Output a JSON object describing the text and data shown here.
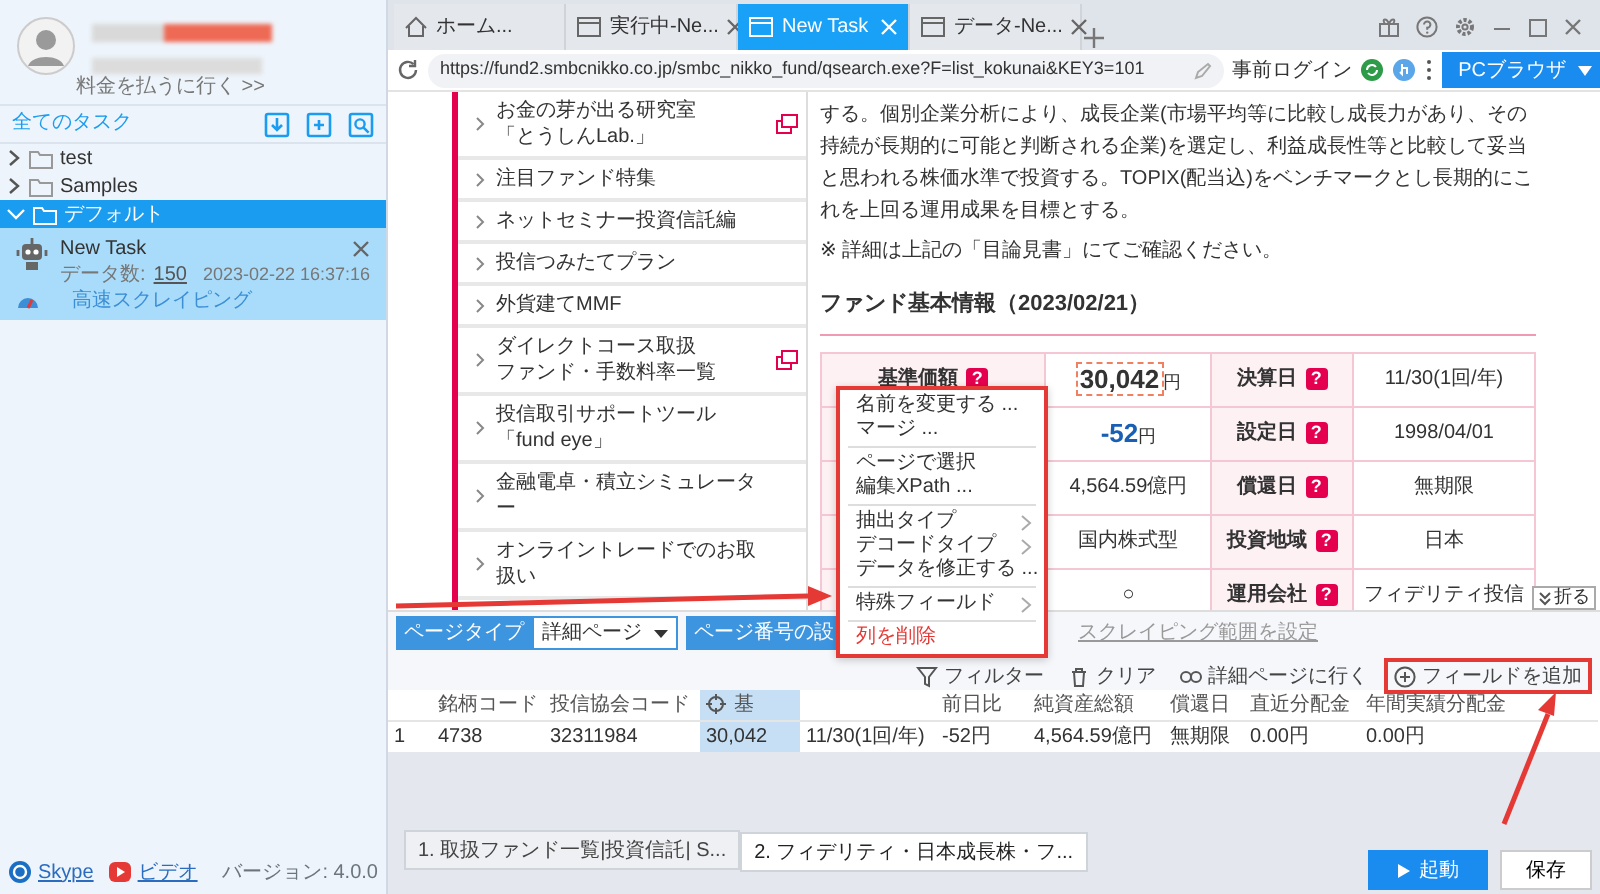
{
  "account": {
    "pay_link": "料金を払うに行く >>"
  },
  "task_panel": {
    "title": "全てのタスク",
    "folders": [
      {
        "label": "test",
        "expanded": false,
        "selected": false
      },
      {
        "label": "Samples",
        "expanded": false,
        "selected": false
      },
      {
        "label": "デフォルト",
        "expanded": true,
        "selected": true,
        "children": [
          {
            "name": "New Task",
            "count_label": "データ数:",
            "count": "150",
            "timestamp": "2023-02-22 16:37:16",
            "mode": "高速スクレイピング"
          }
        ]
      }
    ]
  },
  "footer": {
    "links": [
      {
        "label": "Skype",
        "kind": "chat"
      },
      {
        "label": "ビデオ",
        "kind": "video"
      }
    ],
    "version": "バージョン: 4.0.0"
  },
  "browser_tabs": [
    {
      "label": "ホーム...",
      "kind": "home",
      "closable": false,
      "selected": false
    },
    {
      "label": "実行中-Ne...",
      "kind": "page",
      "closable": true,
      "selected": false
    },
    {
      "label": "New Task",
      "kind": "page",
      "closable": true,
      "selected": true
    },
    {
      "label": "データ-Ne...",
      "kind": "page",
      "closable": true,
      "selected": false
    }
  ],
  "address_bar": {
    "url": "https://fund2.smbcnikko.co.jp/smbc_nikko_fund/qsearch.exe?F=list_kokunai&KEY3=101",
    "pre_login": "事前ログイン",
    "mode_button": "PCブラウザ"
  },
  "web_page": {
    "nav_items": [
      {
        "lines": [
          "お金の芽が出る研究室",
          "「とうしんLab.」"
        ],
        "external": true
      },
      {
        "lines": [
          "注目ファンド特集"
        ],
        "external": false
      },
      {
        "lines": [
          "ネットセミナー投資信託編"
        ],
        "external": false
      },
      {
        "lines": [
          "投信つみたてプラン"
        ],
        "external": false
      },
      {
        "lines": [
          "外貨建てMMF"
        ],
        "external": false
      },
      {
        "lines": [
          "ダイレクトコース取扱",
          "ファンド・手数料率一覧"
        ],
        "external": true
      },
      {
        "lines": [
          "投信取引サポートツール",
          "「fund eye」"
        ],
        "external": false
      },
      {
        "lines": [
          "金融電卓・積立シミュレータ",
          "ー"
        ],
        "external": false
      },
      {
        "lines": [
          "オンライントレードでのお取",
          "扱い"
        ],
        "external": false
      }
    ],
    "paragraph": "する。個別企業分析により、成長企業(市場平均等に比較し成長力があり、その持続が長期的に可能と判断される企業)を選定し、利益成長性等と比較して妥当と思われる株価水準で投資する。TOPIX(配当込)をベンチマークとし長期的にこれを上回る運用成果を目標とする。",
    "note": "※ 詳細は上記の「目論見書」にてご確認ください。",
    "section_title": "ファンド基本情報（2023/02/21）",
    "info_rows": [
      {
        "cells": [
          {
            "kind": "label",
            "text": "基準価額",
            "help": "?"
          },
          {
            "kind": "price",
            "text": "30,042",
            "unit": "円"
          },
          {
            "kind": "label",
            "text": "決算日",
            "help": "?"
          },
          {
            "kind": "value",
            "text": "11/30(1回/年)"
          }
        ]
      },
      {
        "cells": [
          {
            "kind": "label"
          },
          {
            "kind": "change",
            "text": "-52",
            "unit": "円"
          },
          {
            "kind": "label",
            "text": "設定日",
            "help": "?"
          },
          {
            "kind": "value",
            "text": "1998/04/01"
          }
        ]
      },
      {
        "cells": [
          {
            "kind": "label"
          },
          {
            "kind": "value",
            "text": "4,564.59億円"
          },
          {
            "kind": "label",
            "text": "償還日",
            "help": "?"
          },
          {
            "kind": "value",
            "text": "無期限"
          }
        ]
      },
      {
        "cells": [
          {
            "kind": "label"
          },
          {
            "kind": "value",
            "text": "国内株式型"
          },
          {
            "kind": "label",
            "text": "投資地域",
            "help": "?"
          },
          {
            "kind": "value",
            "text": "日本"
          }
        ]
      },
      {
        "cells": [
          {
            "kind": "label"
          },
          {
            "kind": "value",
            "text": "○"
          },
          {
            "kind": "label",
            "text": "運用会社",
            "help": "?"
          },
          {
            "kind": "value",
            "text": "フィデリティ投信"
          }
        ]
      }
    ],
    "collapse_button": "折る"
  },
  "context_menu": [
    {
      "kind": "item",
      "label": "名前を変更する ..."
    },
    {
      "kind": "item",
      "label": "マージ ..."
    },
    {
      "kind": "divider"
    },
    {
      "kind": "item",
      "label": "ページで選択"
    },
    {
      "kind": "item",
      "label": "編集XPath ..."
    },
    {
      "kind": "divider"
    },
    {
      "kind": "submenu",
      "label": "抽出タイプ"
    },
    {
      "kind": "submenu",
      "label": "デコードタイプ"
    },
    {
      "kind": "item",
      "label": "データを修正する ..."
    },
    {
      "kind": "divider"
    },
    {
      "kind": "submenu",
      "label": "特殊フィールド"
    },
    {
      "kind": "divider"
    },
    {
      "kind": "danger",
      "label": "列を削除"
    }
  ],
  "toolbar": {
    "page_type_label": "ページタイプ",
    "page_type_value": "詳細ページ",
    "page_number_button": "ページ番号の設",
    "scrape_range_link": "スクレイピング範囲を設定",
    "actions": [
      {
        "kind": "filter",
        "label": "フィルター",
        "highlighted": false
      },
      {
        "kind": "clear",
        "label": "クリア",
        "highlighted": false
      },
      {
        "kind": "link",
        "label": "詳細ページに行く",
        "highlighted": false
      },
      {
        "kind": "add",
        "label": "フィールドを追加",
        "highlighted": true
      }
    ]
  },
  "field_table": {
    "columns": [
      {
        "label": "銘柄コード",
        "selected": false
      },
      {
        "label": "投信協会コード",
        "selected": false
      },
      {
        "label": "基",
        "selected": true
      },
      {
        "selected": false
      },
      {
        "label": "前日比",
        "selected": false
      },
      {
        "label": "純資産総額",
        "selected": false
      },
      {
        "label": "償還日",
        "selected": false
      },
      {
        "label": "直近分配金",
        "selected": false
      },
      {
        "label": "年間実績分配金",
        "selected": false
      }
    ],
    "rows": [
      {
        "index": "1",
        "cells": [
          "4738",
          "32311984",
          "30,042",
          "11/30(1回/年)",
          "-52円",
          "4,564.59億円",
          "無期限",
          "0.00円",
          "0.00円"
        ]
      }
    ]
  },
  "page_tabs": [
    {
      "label": "1. 取扱ファンド一覧|投資信託| S...",
      "selected": false
    },
    {
      "label": "2. フィデリティ・日本成長株・フ...",
      "selected": true
    }
  ],
  "buttons": {
    "start": "起動",
    "save": "保存"
  }
}
